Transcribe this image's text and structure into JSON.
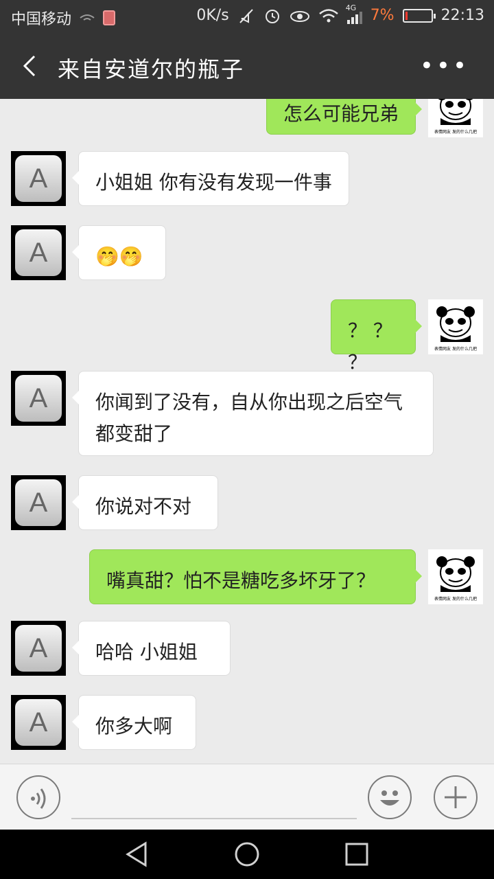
{
  "status_bar": {
    "carrier": "中国移动",
    "net_speed": "0K/s",
    "signal_label": "4G",
    "battery_pct": "7%",
    "time": "22:13"
  },
  "header": {
    "title": "来自安道尔的瓶子"
  },
  "messages": [
    {
      "side": "right",
      "text": "怎么可能兄弟"
    },
    {
      "side": "left",
      "text": "小姐姐 你有没有发现一件事"
    },
    {
      "side": "left",
      "text": "🤭🤭"
    },
    {
      "side": "right",
      "text": "？ ？ ？"
    },
    {
      "side": "left",
      "text": "你闻到了没有，自从你出现之后空气都变甜了"
    },
    {
      "side": "left",
      "text": "你说对不对"
    },
    {
      "side": "right",
      "text": "嘴真甜？怕不是糖吃多坏牙了？"
    },
    {
      "side": "left",
      "text": "哈哈 小姐姐"
    },
    {
      "side": "left",
      "text": "你多大啊"
    }
  ],
  "avatars": {
    "contact_letter": "A",
    "self_caption": "表情网友 发的什么几把"
  },
  "icons": {
    "back": "back-arrow-icon",
    "more": "more-dots-icon",
    "voice": "voice-icon",
    "emoji": "emoji-icon",
    "plus": "plus-icon",
    "nav_back": "nav-back-icon",
    "nav_home": "nav-home-icon",
    "nav_recent": "nav-recent-icon"
  },
  "colors": {
    "header_bg": "#343434",
    "chat_bg": "#ebebeb",
    "own_bubble": "#a0e75a",
    "other_bubble": "#ffffff"
  }
}
